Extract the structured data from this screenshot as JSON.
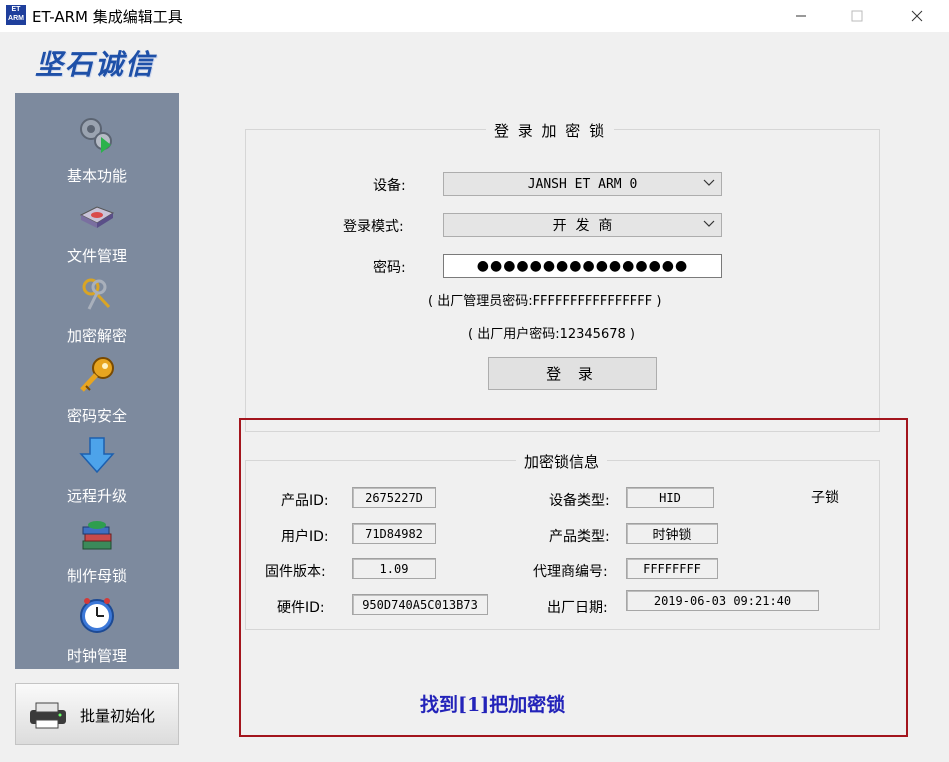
{
  "window": {
    "title": "ET-ARM 集成编辑工具",
    "icon_text": "ET ARM",
    "minimize_icon": "minimize-icon",
    "maximize_icon": "maximize-icon",
    "close_icon": "close-icon"
  },
  "brand": {
    "logo_text": "坚石诚信",
    "logo_color": "#1e50a8"
  },
  "sidebar": {
    "background": "#7d8a9e",
    "items": [
      {
        "label": "基本功能",
        "icon": "gears-play-icon"
      },
      {
        "label": "文件管理",
        "icon": "disk-drive-icon"
      },
      {
        "label": "加密解密",
        "icon": "keys-icon"
      },
      {
        "label": "密码安全",
        "icon": "golden-key-icon"
      },
      {
        "label": "远程升级",
        "icon": "down-arrow-icon"
      },
      {
        "label": "制作母锁",
        "icon": "book-stack-icon"
      },
      {
        "label": "时钟管理",
        "icon": "clock-icon"
      }
    ],
    "batch_button": {
      "label": "批量初始化",
      "icon": "printer-icon"
    }
  },
  "login": {
    "title": "登 录 加 密 锁",
    "device_label": "设备:",
    "device_value": "JANSH ET ARM 0",
    "mode_label": "登录模式:",
    "mode_value": "开  发  商",
    "password_label": "密码:",
    "password_value": "●●●●●●●●●●●●●●●●",
    "admin_hint": "( 出厂管理员密码:FFFFFFFFFFFFFFFF )",
    "user_hint": "( 出厂用户密码:12345678 )",
    "login_button": "登 录"
  },
  "info": {
    "title": "加密锁信息",
    "product_id_label": "产品ID:",
    "product_id": "2675227D",
    "user_id_label": "用户ID:",
    "user_id": "71D84982",
    "firmware_label": "固件版本:",
    "firmware": "1.09",
    "hardware_id_label": "硬件ID:",
    "hardware_id": "950D740A5C013B73",
    "device_type_label": "设备类型:",
    "device_type": "HID",
    "lock_kind": "子锁",
    "product_type_label": "产品类型:",
    "product_type": "时钟锁",
    "agent_label": "代理商编号:",
    "agent": "FFFFFFFF",
    "factory_date_label": "出厂日期:",
    "factory_date": "2019-06-03 09:21:40"
  },
  "status": {
    "found_text": "找到[1]把加密锁",
    "highlight_color": "#a3151d",
    "text_color": "#2323b9"
  }
}
